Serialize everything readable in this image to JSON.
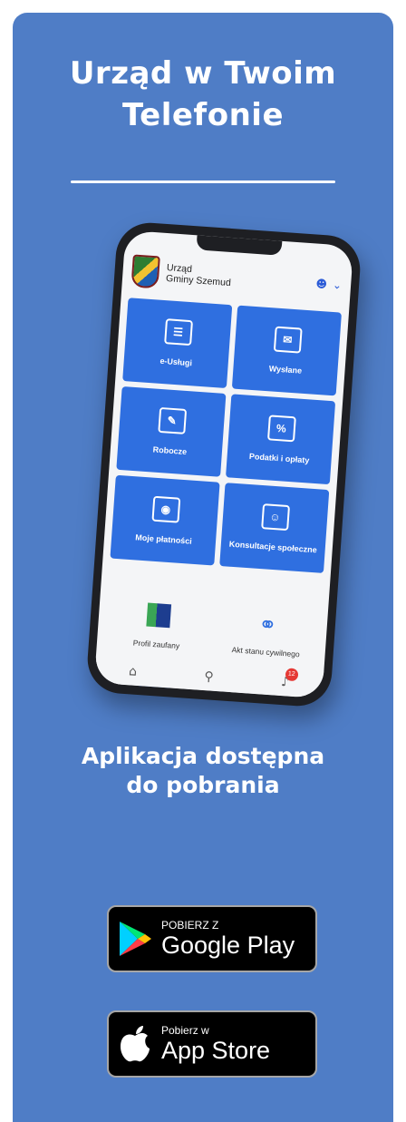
{
  "headline": {
    "line1": "Urząd w Twoim",
    "line2": "Telefonie"
  },
  "app": {
    "header": {
      "line1": "Urząd",
      "line2": "Gminy Szemud"
    },
    "tiles": [
      {
        "label": "e-Usługi",
        "icon": "document-icon"
      },
      {
        "label": "Wysłane",
        "icon": "sent-mail-icon"
      },
      {
        "label": "Robocze",
        "icon": "draft-mail-icon"
      },
      {
        "label": "Podatki i opłaty",
        "icon": "percent-icon"
      },
      {
        "label": "Moje płatności",
        "icon": "coins-icon"
      },
      {
        "label": "Konsultacje społeczne",
        "icon": "people-chat-icon"
      }
    ],
    "lower": [
      {
        "label": "Profil zaufany",
        "icon": "trusted-profile-icon"
      },
      {
        "label": "Akt stanu cywilnego",
        "icon": "rings-icon"
      }
    ],
    "notification_count": "12"
  },
  "availability": {
    "line1": "Aplikacja dostępna",
    "line2": "do pobrania"
  },
  "google_play": {
    "small": "POBIERZ Z",
    "big": "Google Play"
  },
  "app_store": {
    "small": "Pobierz w",
    "big": "App Store"
  },
  "colors": {
    "background": "#4f7dc6",
    "tile": "#2f6fe0"
  }
}
